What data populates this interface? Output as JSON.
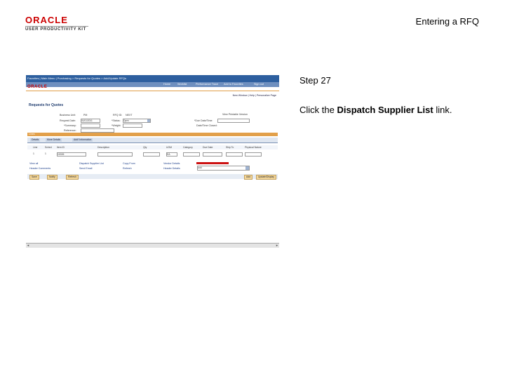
{
  "header": {
    "logo_brand": "ORACLE",
    "logo_product": "USER PRODUCTIVITY KIT",
    "slide_title": "Entering a RFQ"
  },
  "step": {
    "title": "Step 27",
    "instruction_prefix": "Click the ",
    "instruction_link": "Dispatch Supplier List",
    "instruction_suffix": " link."
  },
  "screenshot": {
    "breadcrumb": "Favorites  |  Main Menu  |  Purchasing  >  Requests for Quotes  >  Add/Update RFQs",
    "nav": [
      "Home",
      "Worklist",
      "Performance Trace",
      "Add to Favorites",
      "Sign out"
    ],
    "logo": "ORACLE",
    "top_links": "New Window  |  Help  |  Personalize Page",
    "page_title": "Requests for Quotes",
    "fields": {
      "business_unit_label": "Business Unit:",
      "business_unit_value": "PM",
      "request_date_label": "Request Date:",
      "request_date_value": "01/01/2011",
      "bu_rfq_label": "RFQ ID:",
      "bu_rfq_value": "NEXT",
      "status_label": "*Status:",
      "status_value": "Open",
      "reason_label": "*Summary:",
      "reason_value": "",
      "weight_label": "*Weight:",
      "weight_value": "",
      "due_date_label": "*Due Date/Time:",
      "due_date_value": "",
      "receipt_label": "Date/Time Closed:",
      "reference_label": "Reference:",
      "view_link": "View Printable Version"
    },
    "grid": {
      "title": "Lines",
      "tabs": [
        "Details",
        "More Details",
        "Add'l Information"
      ],
      "columns": [
        "Line",
        "Sched",
        "Item ID",
        "Description",
        "Qty",
        "UOM",
        "Category",
        "Due Date",
        "Ship To",
        "Physical Nature"
      ],
      "row": [
        "1",
        "1",
        "10026",
        "",
        "",
        "EA",
        "",
        "",
        "",
        ""
      ]
    },
    "links": [
      "View all",
      "Dispatch Supplier List",
      "Header Comments",
      "Send Email",
      "Copy From",
      "Refresh",
      "Vendor Details",
      "Header Details"
    ],
    "dropdown_value": "Add",
    "buttons_left": [
      "Save",
      "Notify",
      "Refresh"
    ],
    "buttons_right": [
      "Add",
      "Update/Display"
    ]
  }
}
